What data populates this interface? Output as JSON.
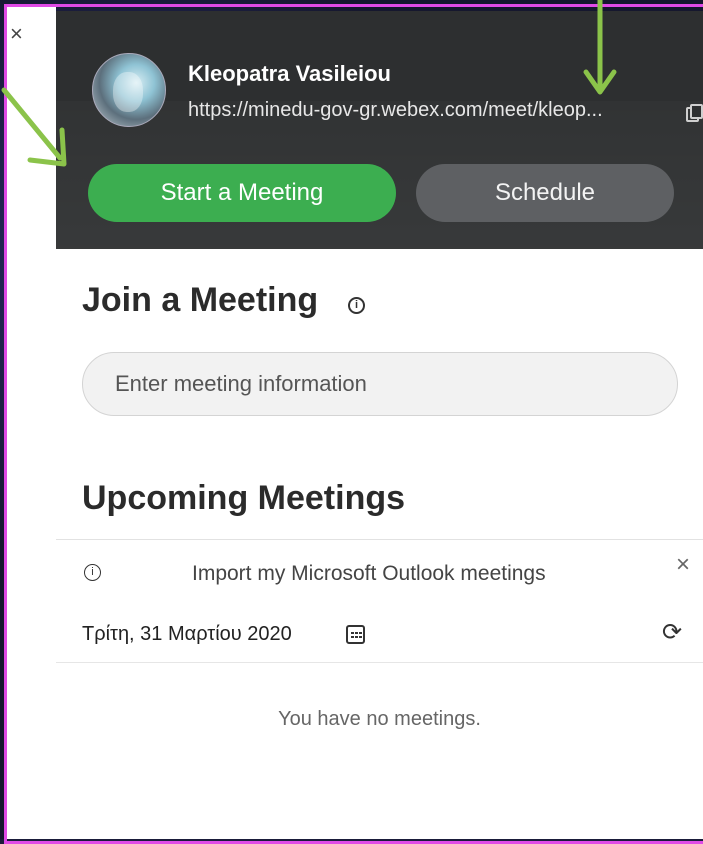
{
  "window": {
    "close_glyph": "×"
  },
  "profile": {
    "name": "Kleopatra Vasileiou",
    "url": "https://minedu-gov-gr.webex.com/meet/kleop..."
  },
  "actions": {
    "start_label": "Start a Meeting",
    "schedule_label": "Schedule"
  },
  "join": {
    "title": "Join a Meeting",
    "info_glyph": "i",
    "input_placeholder": "Enter meeting information"
  },
  "upcoming": {
    "title": "Upcoming Meetings",
    "import_text": "Import my Microsoft Outlook meetings",
    "import_close_glyph": "×",
    "date": "Τρίτη, 31 Μαρτίου 2020",
    "refresh_glyph": "⟳",
    "empty_text": "You have no meetings."
  },
  "colors": {
    "accent_green": "#3cae50",
    "header_bg": "#2d2f30",
    "annotation_arrow": "#8bc34a",
    "frame_border": "#e04ae6"
  }
}
